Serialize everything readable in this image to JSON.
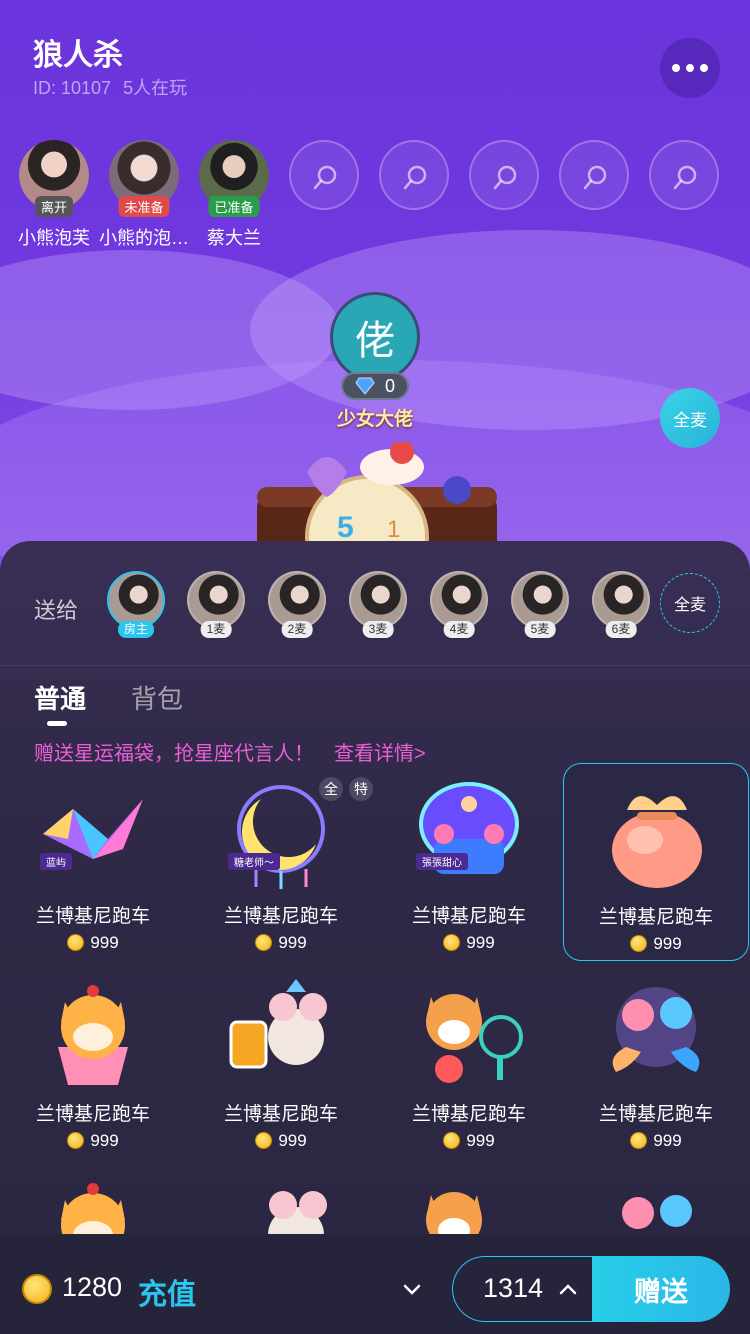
{
  "room": {
    "title": "狼人杀",
    "id_label": "ID: 10107",
    "players_label": "5人在玩"
  },
  "seats": [
    {
      "name": "小熊泡芙",
      "status": "离开",
      "status_color": "#555555"
    },
    {
      "name": "小熊的泡…",
      "status": "未准备",
      "status_color": "#e14a4a"
    },
    {
      "name": "蔡大兰",
      "status": "已准备",
      "status_color": "#2a9d4b"
    }
  ],
  "host": {
    "avatar_char": "佬",
    "diamonds": "0",
    "name": "少女大佬"
  },
  "all_mic_top": "全麦",
  "panel": {
    "send_to_label": "送给",
    "recipients": [
      "房主",
      "1麦",
      "2麦",
      "3麦",
      "4麦",
      "5麦",
      "6麦"
    ],
    "all_mic": "全麦",
    "tabs": [
      "普通",
      "背包"
    ],
    "promo_text": "赠送星运福袋，抢星座代言人！",
    "promo_link": "查看详情>",
    "gift_tags": [
      "全",
      "特"
    ],
    "owners": [
      "蓝屿",
      "糖老师～",
      "張張甜心"
    ],
    "gifts": [
      {
        "name": "兰博基尼跑车",
        "price": "999",
        "icon": "paper-crane-icon"
      },
      {
        "name": "兰博基尼跑车",
        "price": "999",
        "icon": "moon-dreamcatcher-icon"
      },
      {
        "name": "兰博基尼跑车",
        "price": "999",
        "icon": "music-box-icon"
      },
      {
        "name": "兰博基尼跑车",
        "price": "999",
        "icon": "lucky-bag-icon"
      },
      {
        "name": "兰博基尼跑车",
        "price": "999",
        "icon": "shiba-cup-icon"
      },
      {
        "name": "兰博基尼跑车",
        "price": "999",
        "icon": "mouse-juice-icon"
      },
      {
        "name": "兰博基尼跑车",
        "price": "999",
        "icon": "corgi-fan-icon"
      },
      {
        "name": "兰博基尼跑车",
        "price": "999",
        "icon": "pisces-icon"
      },
      {
        "name": "",
        "price": "",
        "icon": "shiba-cup-icon"
      },
      {
        "name": "",
        "price": "",
        "icon": "mouse-juice-icon"
      },
      {
        "name": "",
        "price": "",
        "icon": "corgi-fan-icon"
      },
      {
        "name": "",
        "price": "",
        "icon": "pisces-icon"
      }
    ]
  },
  "footer": {
    "balance": "1280",
    "recharge": "充值",
    "quantity": "1314",
    "send": "赠送"
  },
  "colors": {
    "accent": "#2bc6ee",
    "promo": "#ea5ed7",
    "panel_bg": "#2f2947"
  }
}
